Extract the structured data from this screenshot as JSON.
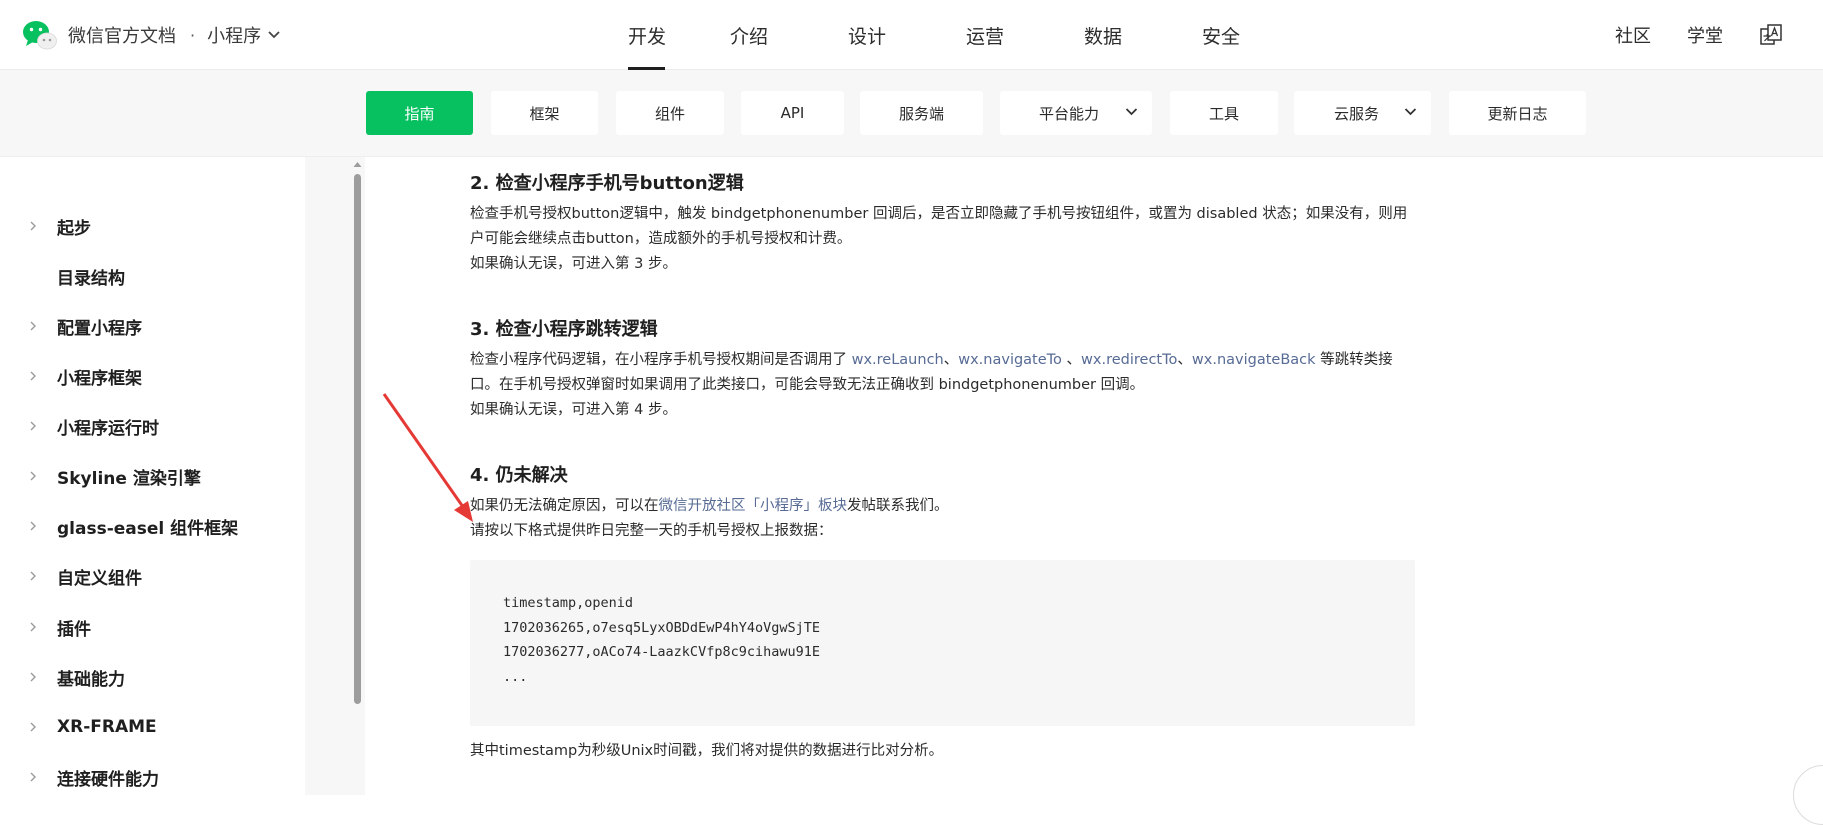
{
  "header": {
    "site_title": "微信官方文档",
    "separator": "·",
    "product": "小程序",
    "nav": [
      "开发",
      "介绍",
      "设计",
      "运营",
      "数据",
      "安全"
    ],
    "active_nav": "开发",
    "right_links": [
      "社区",
      "学堂"
    ],
    "lang_icon": "translate-icon"
  },
  "subnav": {
    "items": [
      "指南",
      "框架",
      "组件",
      "API",
      "服务端",
      "平台能力",
      "工具",
      "云服务",
      "更新日志"
    ],
    "active": "指南",
    "accent_color": "#07c160"
  },
  "sidebar": {
    "items": [
      {
        "label": "起步",
        "has_children": true
      },
      {
        "label": "目录结构",
        "has_children": false
      },
      {
        "label": "配置小程序",
        "has_children": true
      },
      {
        "label": "小程序框架",
        "has_children": true
      },
      {
        "label": "小程序运行时",
        "has_children": true
      },
      {
        "label": "Skyline 渲染引擎",
        "has_children": true
      },
      {
        "label": "glass-easel 组件框架",
        "has_children": true
      },
      {
        "label": "自定义组件",
        "has_children": true
      },
      {
        "label": "插件",
        "has_children": true
      },
      {
        "label": "基础能力",
        "has_children": true
      },
      {
        "label": "XR-FRAME",
        "has_children": true
      },
      {
        "label": "连接硬件能力",
        "has_children": true
      }
    ]
  },
  "content": {
    "s2": {
      "title": "2. 检查小程序手机号button逻辑",
      "p1": "检查手机号授权button逻辑中，触发 bindgetphonenumber 回调后，是否立即隐藏了手机号按钮组件，或置为 disabled 状态；如果没有，则用户可能会继续点击button，造成额外的手机号授权和计费。",
      "p2": "如果确认无误，可进入第 3 步。"
    },
    "s3": {
      "title": "3. 检查小程序跳转逻辑",
      "p1_a": "检查小程序代码逻辑，在小程序手机号授权期间是否调用了 ",
      "link1": "wx.reLaunch",
      "sep1": "、",
      "link2": "wx.navigateTo",
      "sep2": " 、",
      "link3": "wx.redirectTo",
      "sep3": "、",
      "link4": "wx.navigateBack",
      "p1_b": " 等跳转类接口。在手机号授权弹窗时如果调用了此类接口，可能会导致无法正确收到 bindgetphonenumber 回调。",
      "p2": "如果确认无误，可进入第 4 步。"
    },
    "s4": {
      "title": "4. 仍未解决",
      "p1_a": "如果仍无法确定原因，可以在",
      "p1_link": "微信开放社区「小程序」板块",
      "p1_b": "发帖联系我们。",
      "p2": "请按以下格式提供昨日完整一天的手机号授权上报数据：",
      "code": [
        "timestamp,openid",
        "1702036265,o7esq5LyxOBDdEwP4hY4oVgwSjTE",
        "1702036277,oACo74-LaazkCVfp8c9cihawu91E",
        "..."
      ],
      "footer": "其中timestamp为秒级Unix时间戳，我们将对提供的数据进行比对分析。"
    },
    "link_color": "#576b95"
  },
  "annotation_color": "#e53935"
}
